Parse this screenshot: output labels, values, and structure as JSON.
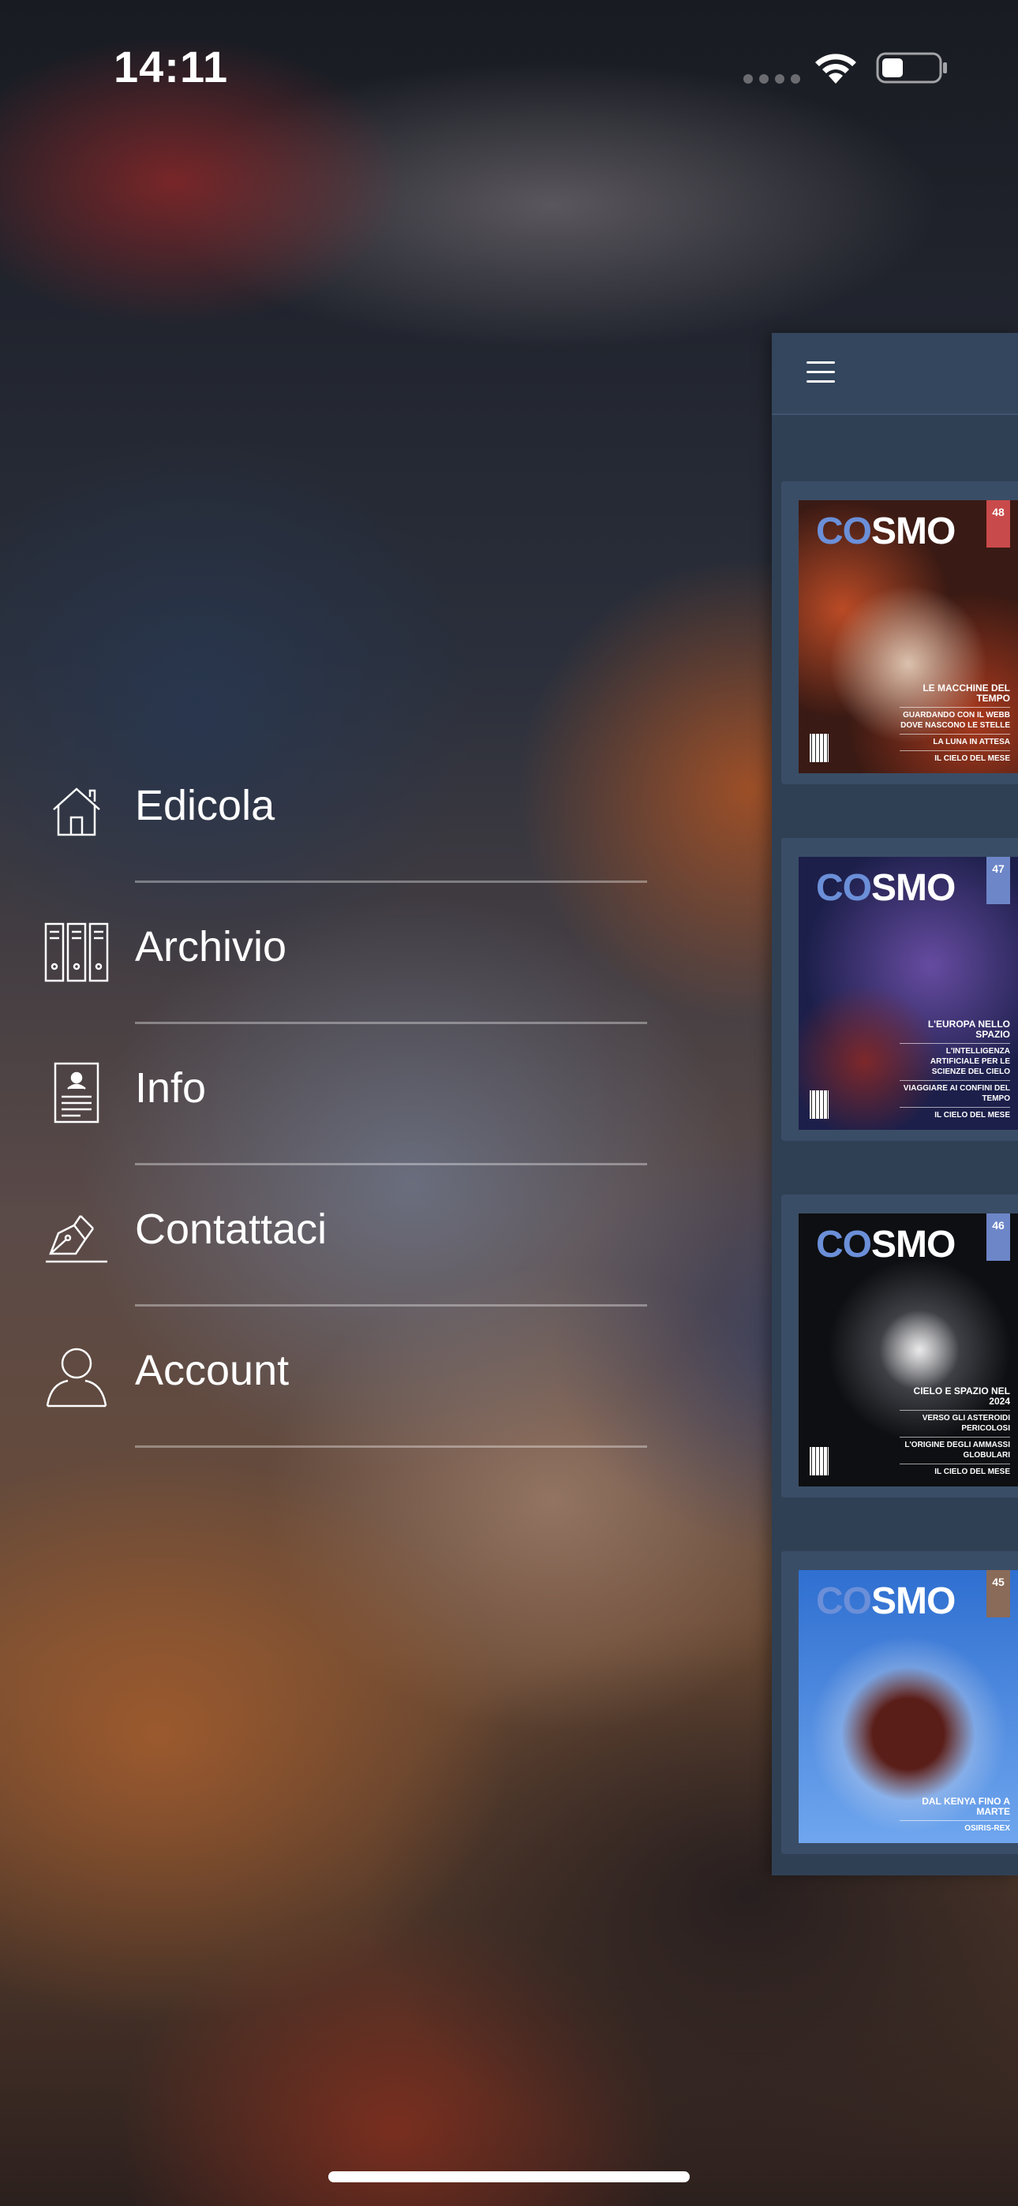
{
  "status_bar": {
    "time": "14:11",
    "battery_level": 0.35
  },
  "menu": {
    "items": [
      {
        "label": "Edicola",
        "icon": "house-icon"
      },
      {
        "label": "Archivio",
        "icon": "binders-icon"
      },
      {
        "label": "Info",
        "icon": "document-icon"
      },
      {
        "label": "Contattaci",
        "icon": "pen-icon"
      },
      {
        "label": "Account",
        "icon": "user-icon"
      }
    ]
  },
  "main": {
    "menu_button_icon": "hamburger-icon",
    "covers": [
      {
        "brand": "COSMO",
        "number": "48",
        "lines": [
          "LE MACCHINE DEL TEMPO",
          "GUARDANDO CON IL WEBB DOVE NASCONO LE STELLE",
          "LA LUNA IN ATTESA",
          "IL CIELO DEL MESE"
        ]
      },
      {
        "brand": "COSMO",
        "number": "47",
        "lines": [
          "L'EUROPA NELLO SPAZIO",
          "L'INTELLIGENZA ARTIFICIALE PER LE SCIENZE DEL CIELO",
          "VIAGGIARE AI CONFINI DEL TEMPO",
          "IL CIELO DEL MESE"
        ]
      },
      {
        "brand": "COSMO",
        "number": "46",
        "lines": [
          "CIELO E SPAZIO NEL 2024",
          "VERSO GLI ASTEROIDI PERICOLOSI",
          "L'ORIGINE DEGLI AMMASSI GLOBULARI",
          "IL CIELO DEL MESE"
        ]
      },
      {
        "brand": "COSMO",
        "number": "45",
        "lines": [
          "DAL KENYA FINO A MARTE",
          "OSIRIS-REX"
        ]
      }
    ]
  }
}
